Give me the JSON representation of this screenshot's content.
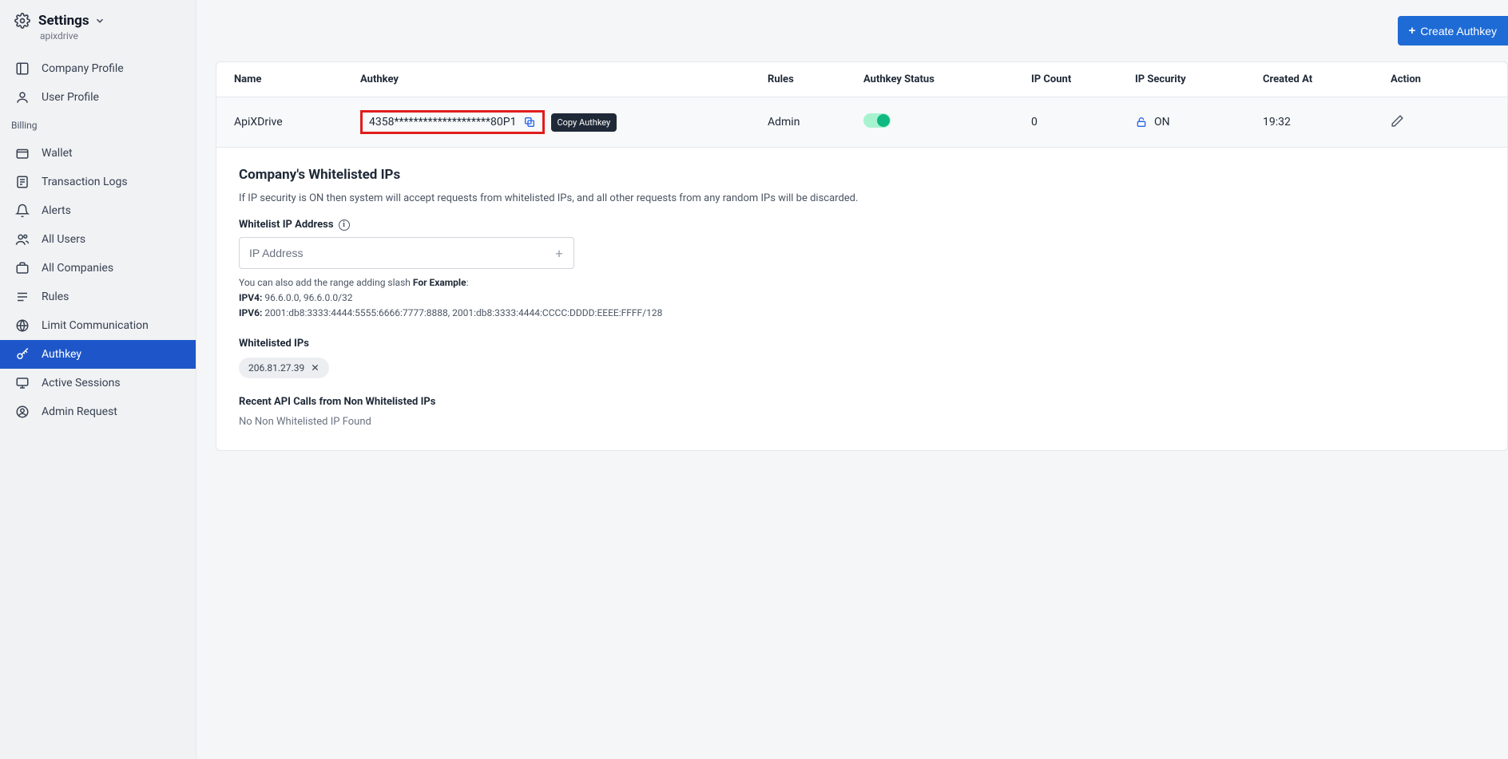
{
  "header": {
    "title": "Settings",
    "subtitle": "apixdrive"
  },
  "sidebar": {
    "main": [
      {
        "label": "Company Profile",
        "icon": "layout"
      },
      {
        "label": "User Profile",
        "icon": "user"
      }
    ],
    "billing_label": "Billing",
    "billing": [
      {
        "label": "Wallet",
        "icon": "wallet"
      },
      {
        "label": "Transaction Logs",
        "icon": "logs"
      },
      {
        "label": "Alerts",
        "icon": "bell"
      },
      {
        "label": "All Users",
        "icon": "users"
      },
      {
        "label": "All Companies",
        "icon": "briefcase"
      },
      {
        "label": "Rules",
        "icon": "rules"
      },
      {
        "label": "Limit Communication",
        "icon": "globe"
      },
      {
        "label": "Authkey",
        "icon": "key",
        "active": true
      },
      {
        "label": "Active Sessions",
        "icon": "sessions"
      },
      {
        "label": "Admin Request",
        "icon": "admin"
      }
    ]
  },
  "actions": {
    "create_authkey": "Create Authkey"
  },
  "table": {
    "headers": {
      "name": "Name",
      "authkey": "Authkey",
      "rules": "Rules",
      "status": "Authkey Status",
      "ipcount": "IP Count",
      "ipsec": "IP Security",
      "created": "Created At",
      "action": "Action"
    },
    "row": {
      "name": "ApiXDrive",
      "authkey": "4358********************80P1",
      "copy_tooltip": "Copy Authkey",
      "rules": "Admin",
      "ipcount": "0",
      "ipsec": "ON",
      "created": "19:32"
    }
  },
  "whitelist": {
    "title": "Company's Whitelisted IPs",
    "hint": "If IP security is ON then system will accept requests from whitelisted IPs, and all other requests from any random IPs will be discarded.",
    "field_label": "Whitelist IP Address",
    "placeholder": "IP Address",
    "help_pre": "You can also add the range adding slash ",
    "help_for": "For Example",
    "ipv4_label": "IPV4:",
    "ipv4_example": " 96.6.0.0, 96.6.0.0/32",
    "ipv6_label": "IPV6:",
    "ipv6_example": " 2001:db8:3333:4444:5555:6666:7777:8888, 2001:db8:3333:4444:CCCC:DDDD:EEEE:FFFF/128",
    "list_title": "Whitelisted IPs",
    "ips": [
      "206.81.27.39"
    ],
    "recent_title": "Recent API Calls from Non Whitelisted IPs",
    "recent_empty": "No Non Whitelisted IP Found"
  }
}
